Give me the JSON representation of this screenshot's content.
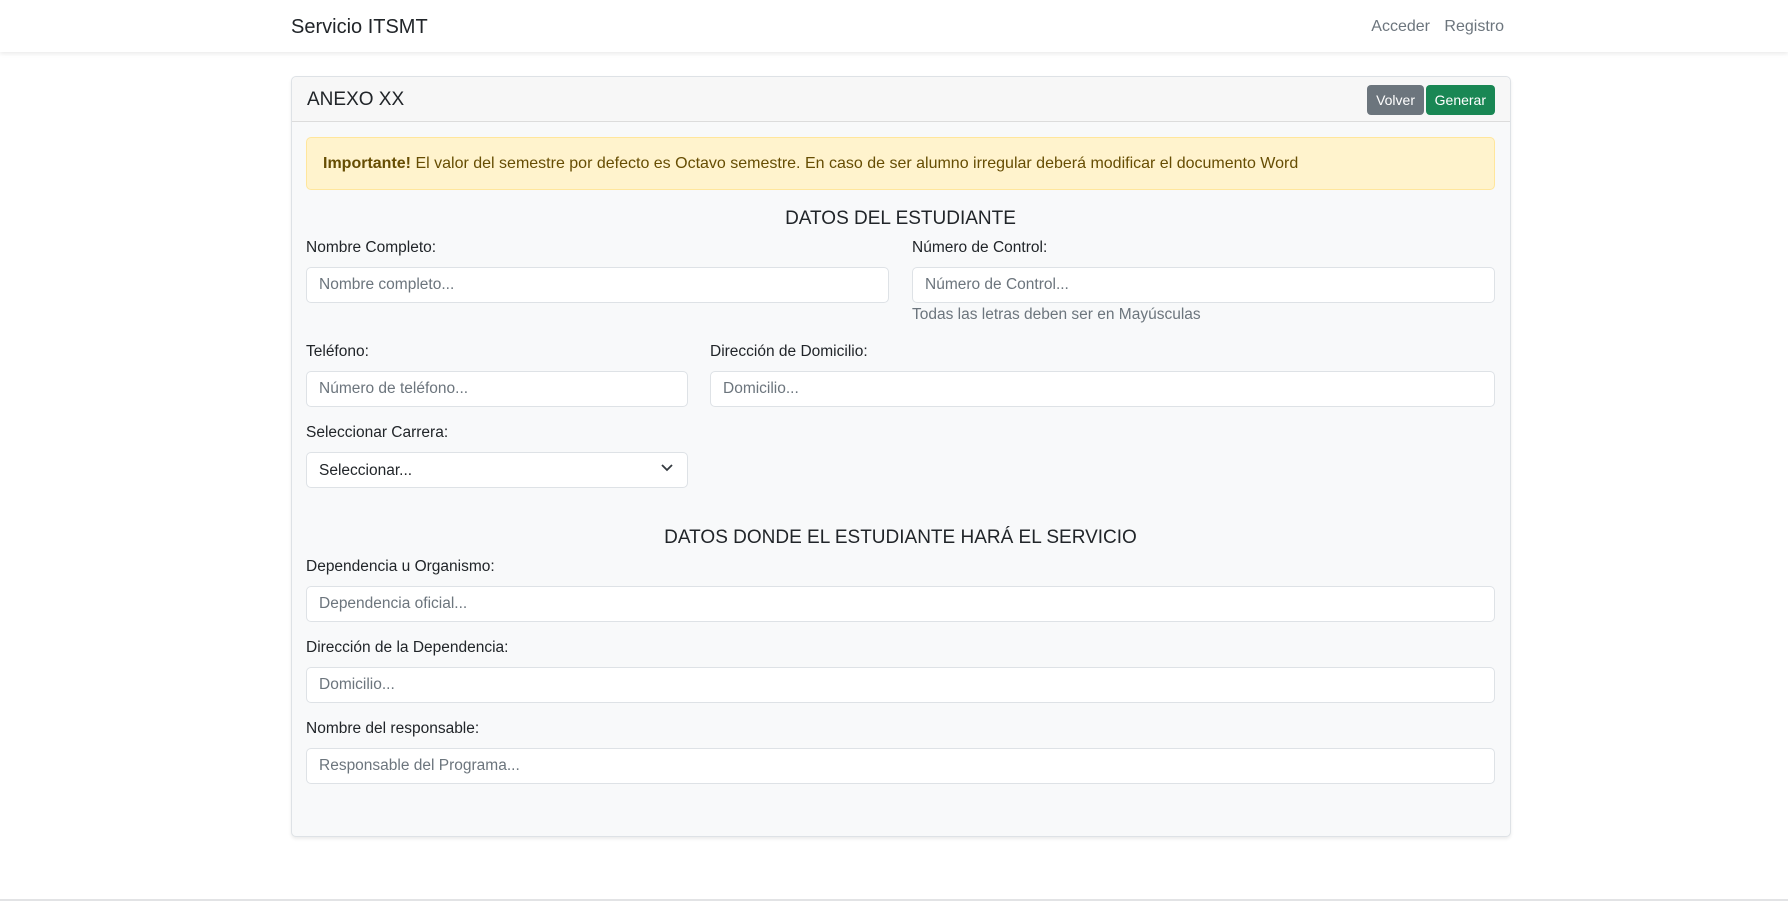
{
  "nav": {
    "brand": "Servicio ITSMT",
    "links": [
      "Acceder",
      "Registro"
    ]
  },
  "card": {
    "title": "ANEXO XX",
    "back_label": "Volver",
    "generate_label": "Generar"
  },
  "alert": {
    "strong": "Importante!",
    "text": " El valor del semestre por defecto es Octavo semestre. En caso de ser alumno irregular deberá modificar el documento Word"
  },
  "student": {
    "title": "DATOS DEL ESTUDIANTE",
    "name": {
      "label": "Nombre Completo:",
      "placeholder": "Nombre completo..."
    },
    "control": {
      "label": "Número de Control:",
      "placeholder": "Número de Control...",
      "help": "Todas las letras deben ser en Mayúsculas"
    },
    "phone": {
      "label": "Teléfono:",
      "placeholder": "Número de teléfono..."
    },
    "address": {
      "label": "Dirección de Domicilio:",
      "placeholder": "Domicilio..."
    },
    "career": {
      "label": "Seleccionar Carrera:",
      "value": "Seleccionar..."
    }
  },
  "service": {
    "title": "DATOS DONDE EL ESTUDIANTE HARÁ EL SERVICIO",
    "dependency": {
      "label": "Dependencia u Organismo:",
      "placeholder": "Dependencia oficial..."
    },
    "dep_address": {
      "label": "Dirección de la Dependencia:",
      "placeholder": "Domicilio..."
    },
    "responsible": {
      "label": "Nombre del responsable:",
      "placeholder": "Responsable del Programa..."
    }
  }
}
